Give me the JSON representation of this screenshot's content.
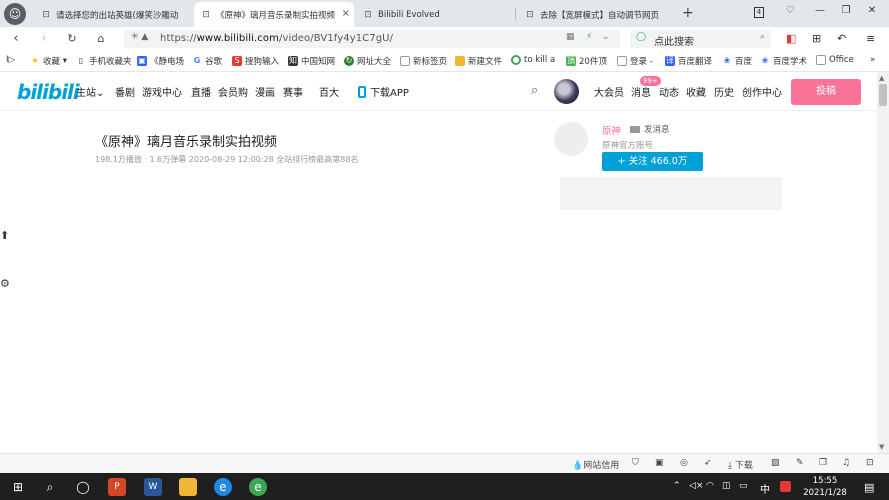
{
  "browser": {
    "tabs": [
      {
        "title": "请选择您的出站英雄(爆笑沙雕动",
        "active": false
      },
      {
        "title": "《原神》璃月音乐录制实拍视频",
        "active": true
      },
      {
        "title": "Bilibili Evolved",
        "active": false
      },
      {
        "title": "去除【宽屏模式】自动调节网页",
        "active": false
      }
    ],
    "new_tab_label": "+",
    "close_label": "×",
    "window_controls": {
      "restore": "4",
      "pin": "♡",
      "minimize": "—",
      "maximize": "❐",
      "close": "✕"
    }
  },
  "addressbar": {
    "url_prefix": "https://",
    "url_host": "www.bilibili.com",
    "url_path": "/video/BV1fy4y1C7gU/",
    "search_placeholder": "点此搜索"
  },
  "bookmarks": [
    {
      "label": "收藏",
      "icon": "star-icon",
      "color": "#f4b400"
    },
    {
      "label": "手机收藏夹",
      "icon": "phone-icon",
      "color": "#555555"
    },
    {
      "label": "《静电场",
      "icon": "bookmark-icon",
      "color": "#2962ff"
    },
    {
      "label": "谷歌",
      "icon": "google-icon",
      "color": "#4285f4"
    },
    {
      "label": "搜狗输入",
      "icon": "sogou-icon",
      "color": "#e53935"
    },
    {
      "label": "中国知网",
      "icon": "cnki-icon",
      "color": "#333333"
    },
    {
      "label": "网址大全",
      "icon": "nav-icon",
      "color": "#2e7d32"
    },
    {
      "label": "新标签页",
      "icon": "page-icon",
      "color": "#888888"
    },
    {
      "label": "新建文件",
      "icon": "folder-icon",
      "color": "#f2b632"
    },
    {
      "label": "to kill a",
      "icon": "search-circle-icon",
      "color": "#3aa757"
    },
    {
      "label": "20件顶",
      "icon": "green-square-icon",
      "color": "#4caf50"
    },
    {
      "label": "登录 -",
      "icon": "page-icon",
      "color": "#888888"
    },
    {
      "label": "百度翻译",
      "icon": "baidu-translate-icon",
      "color": "#2962ff"
    },
    {
      "label": "百度",
      "icon": "baidu-icon",
      "color": "#2962ff"
    },
    {
      "label": "百度学术",
      "icon": "baidu-scholar-icon",
      "color": "#2962ff"
    },
    {
      "label": "Office",
      "icon": "page-icon",
      "color": "#888888"
    }
  ],
  "bilibili": {
    "logo": "bilibili",
    "nav_left": [
      "主站",
      "番剧",
      "游戏中心",
      "直播",
      "会员购",
      "漫画",
      "赛事",
      "百大"
    ],
    "download_app": "下载APP",
    "nav_right": [
      "大会员",
      "消息",
      "动态",
      "收藏",
      "历史",
      "创作中心"
    ],
    "message_badge": "99+",
    "post_button": "投稿",
    "brand_pink": "#fb7299",
    "brand_blue": "#00a1d6"
  },
  "video": {
    "title": "《原神》璃月音乐录制实拍视频",
    "meta": "198.1万播放 · 1.6万弹幕    2020-08-29 12:00:28   全站排行榜最高第88名"
  },
  "uploader": {
    "name": "原神",
    "message_label": "发消息",
    "description": "原神官方账号",
    "follow_label": "+ 关注 466.0万"
  },
  "statusbar": {
    "site_credit": "网站信用",
    "download": "下载"
  },
  "taskbar": {
    "time": "15:55",
    "date": "2021/1/28",
    "ime": "中"
  }
}
